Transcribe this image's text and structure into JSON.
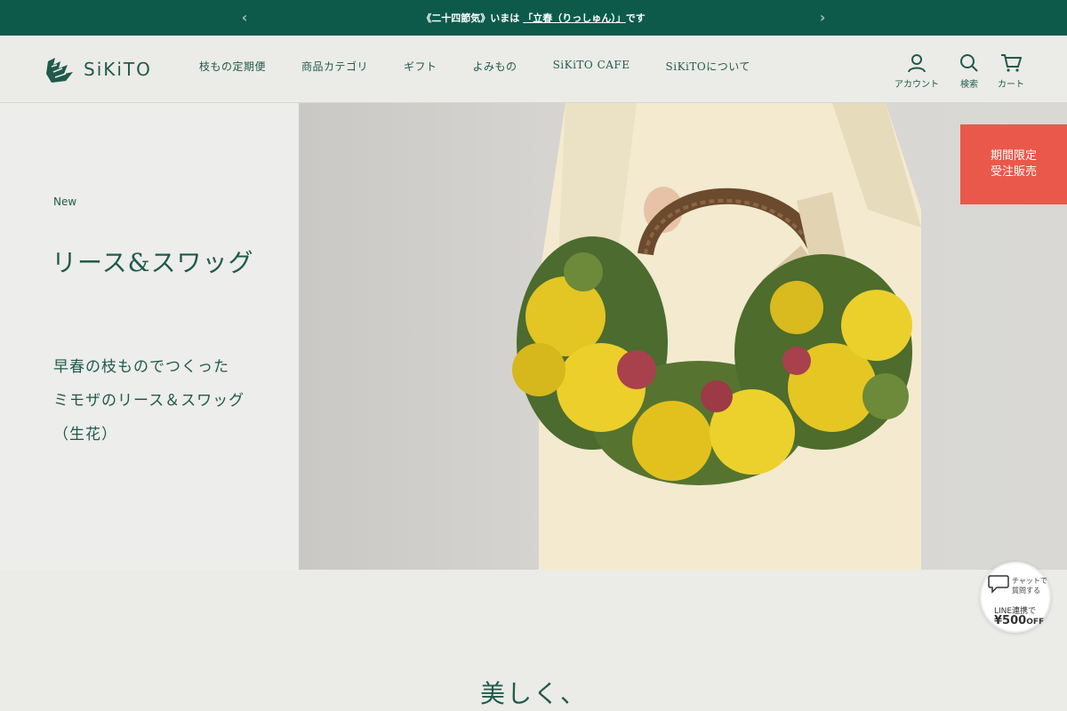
{
  "announcement": {
    "prefix": "《二十四節気》いまは",
    "link": "「立春（りっしゅん）」",
    "suffix": "です",
    "prev_icon": "chevron-left-icon",
    "next_icon": "chevron-right-icon"
  },
  "header": {
    "logo_text": "SiKiTO",
    "nav": [
      "枝もの定期便",
      "商品カテゴリ",
      "ギフト",
      "よみもの",
      "SiKiTO CAFE",
      "SiKiTOについて"
    ],
    "account_label": "アカウント",
    "search_label": "検索",
    "cart_label": "カート"
  },
  "hero": {
    "tag": "New",
    "title": "リース&スワッグ",
    "sub_lines": [
      "早春の枝ものでつくった",
      "ミモザのリース＆スワッグ",
      "（生花）"
    ]
  },
  "limited_badge": [
    "期間限定",
    "受注販売"
  ],
  "chat_badge": {
    "line1": "チャットで",
    "line2": "質問する",
    "line3": "LINE連携で",
    "amount": "¥500",
    "off": "OFF"
  },
  "lower": {
    "heading": "美しく、"
  },
  "colors": {
    "brand_green": "#0d5a4b",
    "text_green": "#1f5a4c",
    "badge_red": "#e9584a",
    "background": "#ebebe7"
  }
}
